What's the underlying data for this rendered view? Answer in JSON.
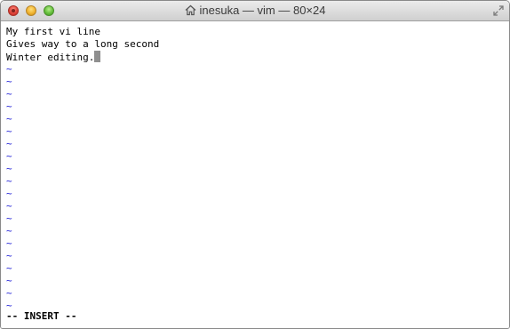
{
  "window": {
    "title": "inesuka — vim — 80×24",
    "title_icon": "home-icon",
    "fullscreen_icon": "fullscreen-icon"
  },
  "editor": {
    "lines": [
      "My first vi line",
      "Gives way to a long second",
      "Winter editing."
    ],
    "empty_line_marker": "~",
    "empty_line_count": 20,
    "cursor_after_line": 3,
    "status": "-- INSERT --"
  },
  "colors": {
    "tilde": "#1c1cd6",
    "cursor": "#8f8f8f",
    "close": "#e0443a",
    "minimize": "#f0b330",
    "zoom": "#66bf3c"
  }
}
